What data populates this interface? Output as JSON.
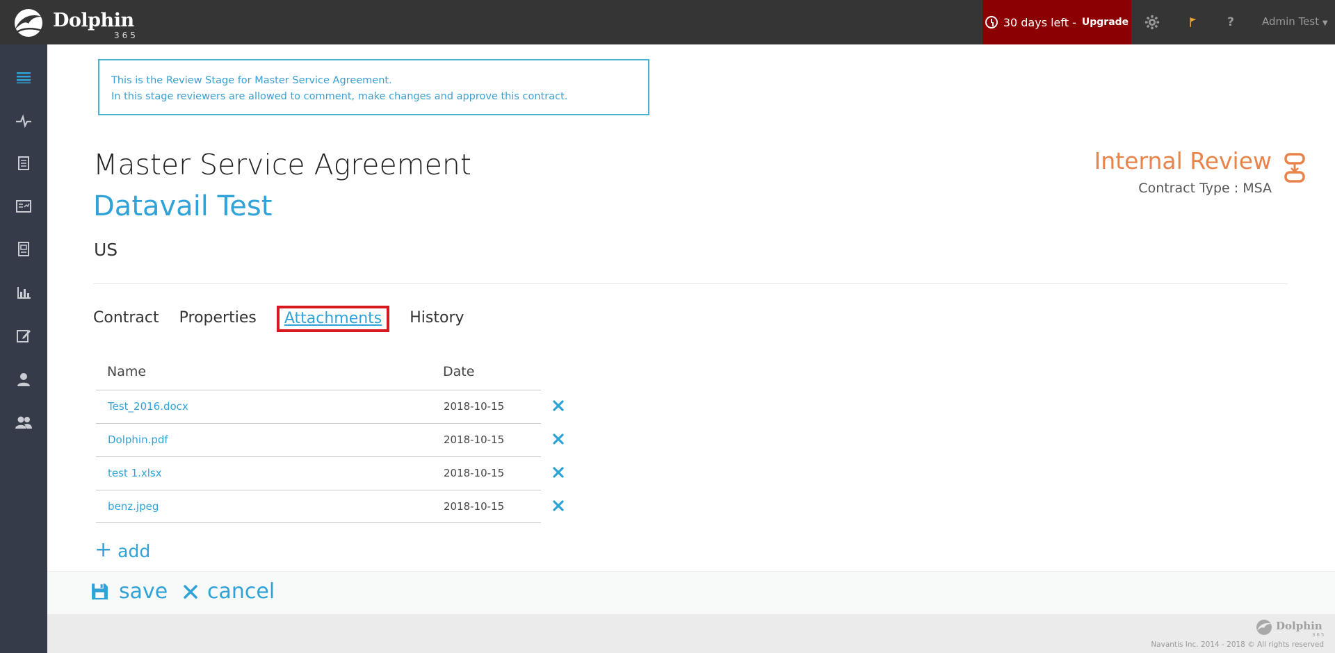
{
  "app": {
    "brand": "Dolphin",
    "brand_sub": "365"
  },
  "topbar": {
    "trial_text": "30 days left - ",
    "upgrade_label": "Upgrade",
    "user_name": "Admin Test"
  },
  "colors": {
    "accent": "#2fa3d8",
    "status": "#e8834a",
    "trial_bg": "#8b0000",
    "sidebar_bg": "#363b49",
    "topbar_bg": "#353535"
  },
  "info": {
    "line1": "This is the Review Stage for Master Service Agreement.",
    "line2": "In this stage reviewers are allowed to comment, make changes and approve this contract."
  },
  "contract": {
    "title": "Master Service Agreement",
    "party": "Datavail Test",
    "region": "US",
    "stage": "Internal Review",
    "type_label": "Contract Type : MSA"
  },
  "tabs": [
    {
      "label": "Contract"
    },
    {
      "label": "Properties"
    },
    {
      "label": "Attachments"
    },
    {
      "label": "History"
    }
  ],
  "attachments": {
    "headers": {
      "name": "Name",
      "date": "Date"
    },
    "rows": [
      {
        "name": "Test_2016.docx",
        "date": "2018-10-15"
      },
      {
        "name": "Dolphin.pdf",
        "date": "2018-10-15"
      },
      {
        "name": "test 1.xlsx",
        "date": "2018-10-15"
      },
      {
        "name": "benz.jpeg",
        "date": "2018-10-15"
      }
    ],
    "add_label": "add"
  },
  "actions": {
    "save_label": "save",
    "cancel_label": "cancel"
  },
  "footer": {
    "brand": "Dolphin",
    "brand_sub": "365",
    "copyright": "Navantis Inc. 2014 - 2018 © All rights reserved"
  }
}
